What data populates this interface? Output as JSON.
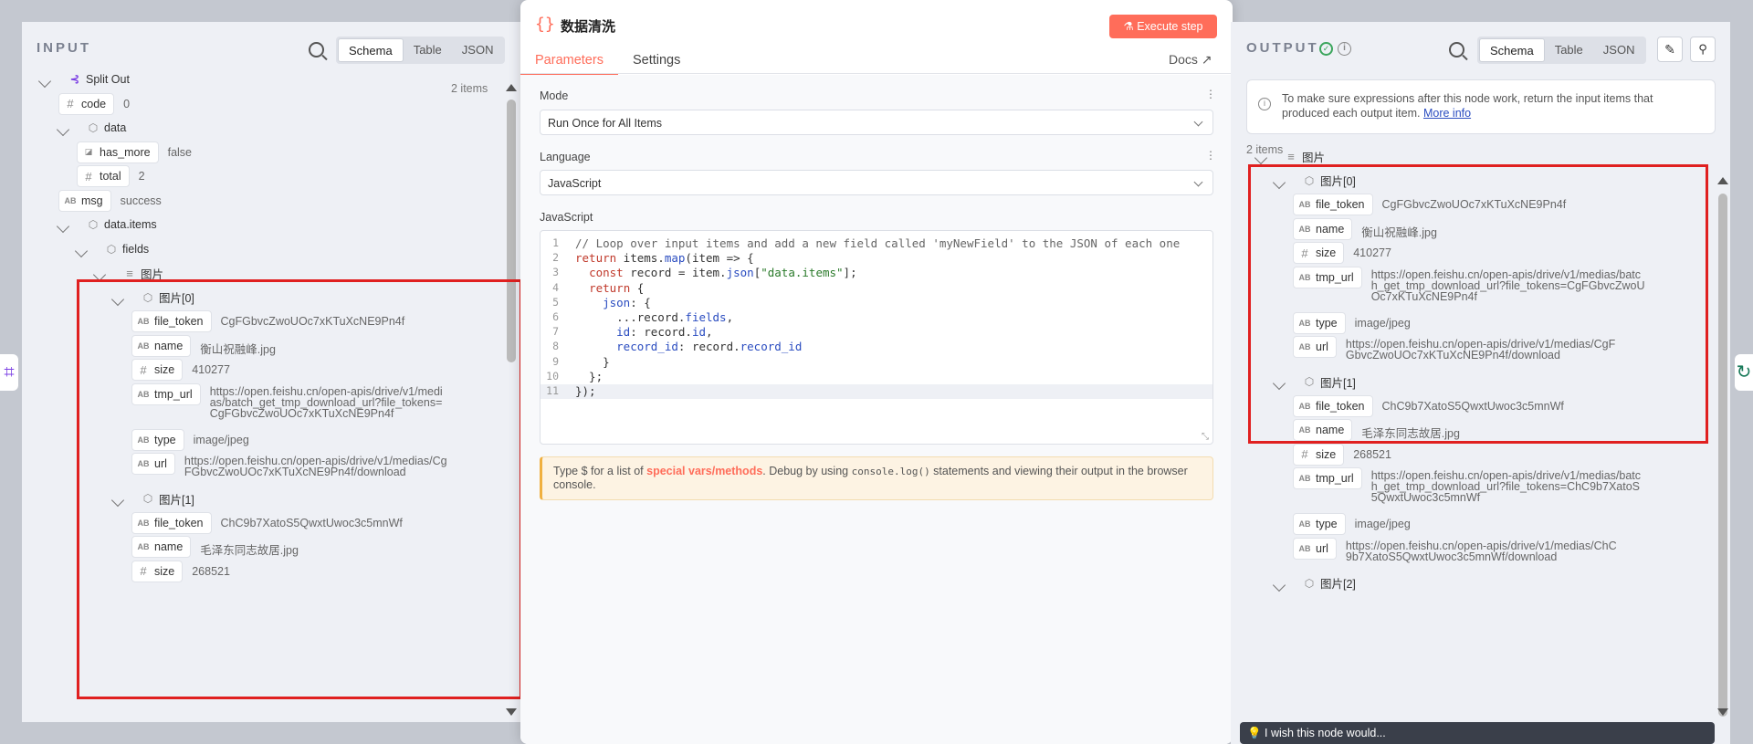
{
  "input": {
    "title": "INPUT",
    "tabs": [
      "Schema",
      "Table",
      "JSON"
    ],
    "active_tab": "Schema",
    "count": "2 items",
    "tree": [
      {
        "kind": "node",
        "type": "split",
        "label": "Split Out",
        "depth": 0,
        "chev": true
      },
      {
        "kind": "field",
        "type": "#",
        "label": "code",
        "value": "0",
        "depth": 1
      },
      {
        "kind": "obj",
        "label": "data",
        "depth": 1,
        "chev": true
      },
      {
        "kind": "field",
        "type": "bool",
        "label": "has_more",
        "value": "false",
        "depth": 2
      },
      {
        "kind": "field",
        "type": "#",
        "label": "total",
        "value": "2",
        "depth": 2
      },
      {
        "kind": "field",
        "type": "AB",
        "label": "msg",
        "value": "success",
        "depth": 1
      },
      {
        "kind": "obj",
        "label": "data.items",
        "depth": 1,
        "chev": true
      },
      {
        "kind": "obj",
        "label": "fields",
        "depth": 2,
        "chev": true
      },
      {
        "kind": "arr",
        "label": "图片",
        "depth": 3,
        "chev": true
      },
      {
        "kind": "obj",
        "label": "图片[0]",
        "depth": 4,
        "chev": true
      },
      {
        "kind": "field",
        "type": "AB",
        "label": "file_token",
        "value": "CgFGbvcZwoUOc7xKTuXcNE9Pn4f",
        "depth": 5
      },
      {
        "kind": "field",
        "type": "AB",
        "label": "name",
        "value": "衡山祝融峰.jpg",
        "depth": 5
      },
      {
        "kind": "field",
        "type": "#",
        "label": "size",
        "value": "410277",
        "depth": 5
      },
      {
        "kind": "field",
        "type": "AB",
        "label": "tmp_url",
        "value": "https://open.feishu.cn/open-apis/drive/v1/medias/batch_get_tmp_download_url?file_tokens=CgFGbvcZwoUOc7xKTuXcNE9Pn4f",
        "depth": 5,
        "wrapw": 260
      },
      {
        "kind": "field",
        "type": "AB",
        "label": "type",
        "value": "image/jpeg",
        "depth": 5
      },
      {
        "kind": "field",
        "type": "AB",
        "label": "url",
        "value": "https://open.feishu.cn/open-apis/drive/v1/medias/CgFGbvcZwoUOc7xKTuXcNE9Pn4f/download",
        "depth": 5,
        "wrapw": 290
      },
      {
        "kind": "obj",
        "label": "图片[1]",
        "depth": 4,
        "chev": true
      },
      {
        "kind": "field",
        "type": "AB",
        "label": "file_token",
        "value": "ChC9b7XatoS5QwxtUwoc3c5mnWf",
        "depth": 5
      },
      {
        "kind": "field",
        "type": "AB",
        "label": "name",
        "value": "毛泽东同志故居.jpg",
        "depth": 5
      },
      {
        "kind": "field",
        "type": "#",
        "label": "size",
        "value": "268521",
        "depth": 5
      }
    ]
  },
  "node": {
    "title": "数据清洗",
    "execute_label": "Execute step",
    "tabs": [
      "Parameters",
      "Settings"
    ],
    "active_tab": "Parameters",
    "docs_label": "Docs",
    "mode_label": "Mode",
    "mode_value": "Run Once for All Items",
    "language_label": "Language",
    "language_value": "JavaScript",
    "code_label": "JavaScript",
    "hint_prefix": "Type $ for a list of ",
    "hint_link": "special vars/methods",
    "hint_mid": ". Debug by using ",
    "hint_code": "console.log()",
    "hint_suffix": " statements and viewing their output in the browser console."
  },
  "code_lines": [
    "// Loop over input items and add a new field called 'myNewField' to the JSON of each one",
    "return items.map(item => {",
    "  const record = item.json[\"data.items\"];",
    "  return {",
    "    json: {",
    "      ...record.fields,",
    "      id: record.id,",
    "      record_id: record.record_id",
    "    }",
    "  };",
    "});"
  ],
  "output": {
    "title": "OUTPUT",
    "tabs": [
      "Schema",
      "Table",
      "JSON"
    ],
    "active_tab": "Schema",
    "notice": "To make sure expressions after this node work, return the input items that produced each output item.",
    "notice_link": "More info",
    "count": "2 items",
    "tree": [
      {
        "kind": "arr",
        "label": "图片",
        "depth": 0,
        "chev": true
      },
      {
        "kind": "obj",
        "label": "图片[0]",
        "depth": 1,
        "chev": true
      },
      {
        "kind": "field",
        "type": "AB",
        "label": "file_token",
        "value": "CgFGbvcZwoUOc7xKTuXcNE9Pn4f",
        "depth": 2
      },
      {
        "kind": "field",
        "type": "AB",
        "label": "name",
        "value": "衡山祝融峰.jpg",
        "depth": 2
      },
      {
        "kind": "field",
        "type": "#",
        "label": "size",
        "value": "410277",
        "depth": 2
      },
      {
        "kind": "field",
        "type": "AB",
        "label": "tmp_url",
        "value": "https://open.feishu.cn/open-apis/drive/v1/medias/batch_get_tmp_download_url?file_tokens=CgFGbvcZwoUOc7xKTuXcNE9Pn4f",
        "depth": 2,
        "wrapw": 300
      },
      {
        "kind": "field",
        "type": "AB",
        "label": "type",
        "value": "image/jpeg",
        "depth": 2
      },
      {
        "kind": "field",
        "type": "AB",
        "label": "url",
        "value": "https://open.feishu.cn/open-apis/drive/v1/medias/CgFGbvcZwoUOc7xKTuXcNE9Pn4f/download",
        "depth": 2,
        "wrapw": 300
      },
      {
        "kind": "obj",
        "label": "图片[1]",
        "depth": 1,
        "chev": true
      },
      {
        "kind": "field",
        "type": "AB",
        "label": "file_token",
        "value": "ChC9b7XatoS5QwxtUwoc3c5mnWf",
        "depth": 2
      },
      {
        "kind": "field",
        "type": "AB",
        "label": "name",
        "value": "毛泽东同志故居.jpg",
        "depth": 2
      },
      {
        "kind": "field",
        "type": "#",
        "label": "size",
        "value": "268521",
        "depth": 2
      },
      {
        "kind": "field",
        "type": "AB",
        "label": "tmp_url",
        "value": "https://open.feishu.cn/open-apis/drive/v1/medias/batch_get_tmp_download_url?file_tokens=ChC9b7XatoS5QwxtUwoc3c5mnWf",
        "depth": 2,
        "wrapw": 300
      },
      {
        "kind": "field",
        "type": "AB",
        "label": "type",
        "value": "image/jpeg",
        "depth": 2
      },
      {
        "kind": "field",
        "type": "AB",
        "label": "url",
        "value": "https://open.feishu.cn/open-apis/drive/v1/medias/ChC9b7XatoS5QwxtUwoc3c5mnWf/download",
        "depth": 2,
        "wrapw": 300
      },
      {
        "kind": "obj",
        "label": "图片[2]",
        "depth": 1,
        "chev": true
      }
    ]
  },
  "feedback": "I wish this node would...",
  "colors": {
    "accent": "#ff6d5a",
    "link": "#2a4cc0",
    "highlight": "#e02020",
    "success": "#3ba55c"
  }
}
